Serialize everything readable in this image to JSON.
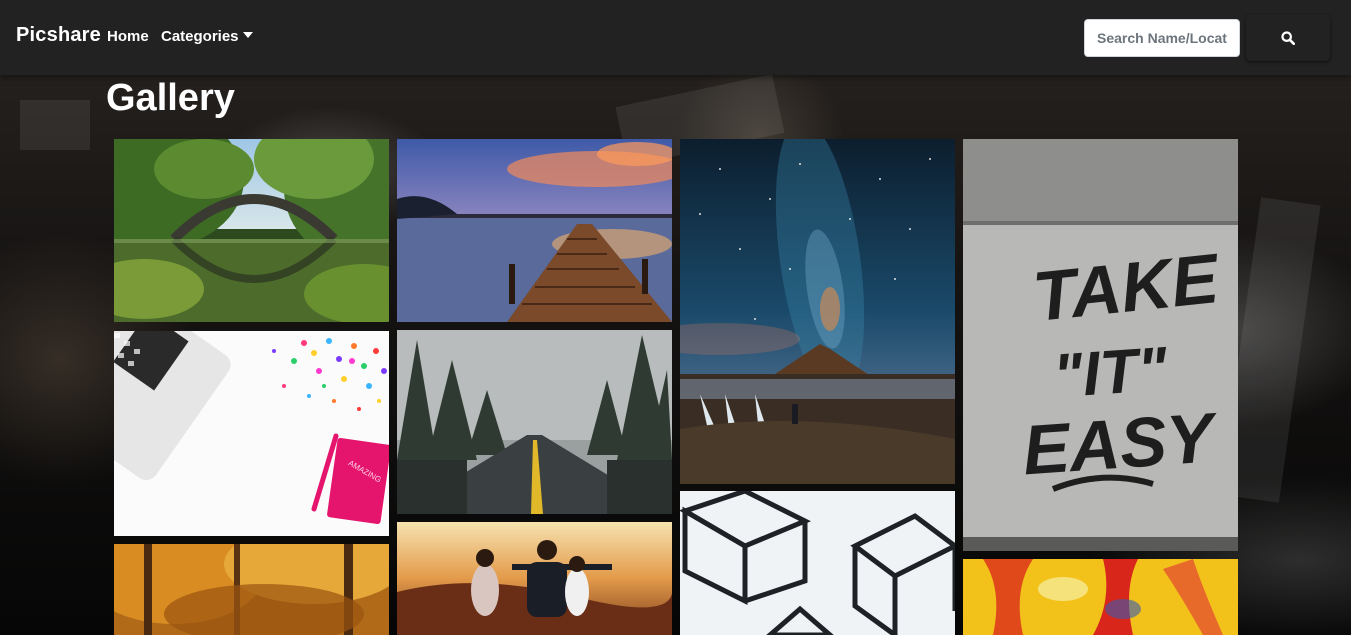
{
  "navbar": {
    "brand": "Picshare",
    "links": [
      "Home",
      "Categories"
    ],
    "search_placeholder": "Search Name/Location"
  },
  "icons": {
    "search": "search-icon",
    "dropdown": "caret-down-icon"
  },
  "page": {
    "title": "Gallery"
  },
  "colors": {
    "navbar_bg": "#222222",
    "page_bg": "#0c0c0c",
    "text": "#ffffff"
  },
  "gallery": {
    "items": [
      "bridge-reflection-photo",
      "wooden-pier-sunset-photo",
      "milky-way-mountain-photo",
      "take-it-easy-graffiti-photo",
      "laptop-confetti-notebook-photo",
      "foggy-forest-road-photo",
      "autumn-forest-photo",
      "friends-sunset-photo",
      "wire-cubes-photo",
      "abstract-paint-photo"
    ],
    "graffiti_text": [
      "TAKE",
      "\"IT\"",
      "EASY"
    ],
    "notebook_text": "AMAZING"
  }
}
